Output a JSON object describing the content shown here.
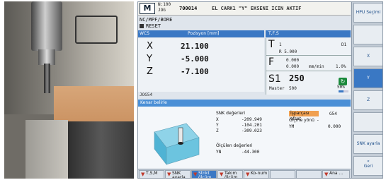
{
  "header": {
    "logo": "M",
    "mode_line1": "N:100",
    "mode_line2": "JOG",
    "code": "700014",
    "message": "EL CARK1 \"Y\" EKSENI ICIN AKTIF"
  },
  "path": "NC/MPF/BORE",
  "status": "RESET",
  "position_panel": {
    "col1": "WCS",
    "col2": "Pozisyon [mm]",
    "axes": [
      {
        "name": "X",
        "value": "21.100"
      },
      {
        "name": "Y",
        "value": "-5.000"
      },
      {
        "name": "Z",
        "value": "-7.100"
      }
    ],
    "program_line": "JOG54"
  },
  "tfs": {
    "title": "T,F,S",
    "t_label": "T",
    "t_value": "1",
    "t_right": "D1",
    "t_radius": "R 5.000",
    "f_label": "F",
    "f_value1": "0.000",
    "f_value2": "0.000",
    "f_unit": "mm/min",
    "f_pct": "1.0%",
    "s_label": "S1",
    "s_value": "250",
    "master_label": "Master",
    "master_value": "500",
    "spindle_pct": "50%",
    "spindle_fraction": 0.5
  },
  "lower": {
    "title": "Kenar belirle",
    "snk_title": "SNK değerleri",
    "snk": [
      {
        "axis": "X",
        "value": "-209.949"
      },
      {
        "axis": "Y",
        "value": "-104.201"
      },
      {
        "axis": "Z",
        "value": "-309.023"
      }
    ],
    "offset_label": "İşparçası ofset",
    "offset_value": "G54",
    "direction_label": "Ölçme yönü",
    "direction_value": "-",
    "ym_label": "YM",
    "ym_value": "0.000",
    "measured_title": "Ölçülen değerleri",
    "measured_axis": "YN",
    "measured_value": "-44.300"
  },
  "softkeys": [
    {
      "label": "T,S,M"
    },
    {
      "label": "SNK ayarla"
    },
    {
      "label": "Stnkt ölçüm"
    },
    {
      "label": "Takım ölçüm"
    },
    {
      "label": "Ko-num"
    },
    {
      "label": ""
    },
    {
      "label": ""
    },
    {
      "label": "Ana ..."
    }
  ],
  "vertical_keys": [
    {
      "label": "HPU Seçimi"
    },
    {
      "label": ""
    },
    {
      "label": "X"
    },
    {
      "label": "Y"
    },
    {
      "label": "Z"
    },
    {
      "label": ""
    },
    {
      "label": "SNK ayarla"
    },
    {
      "label": "Geri"
    }
  ],
  "colors": {
    "header_blue": "#3a78c4",
    "workoffset_orange": "#f0a050",
    "spindle_green": "#1b8a3c",
    "softkey_arrow": "#c0392b"
  }
}
